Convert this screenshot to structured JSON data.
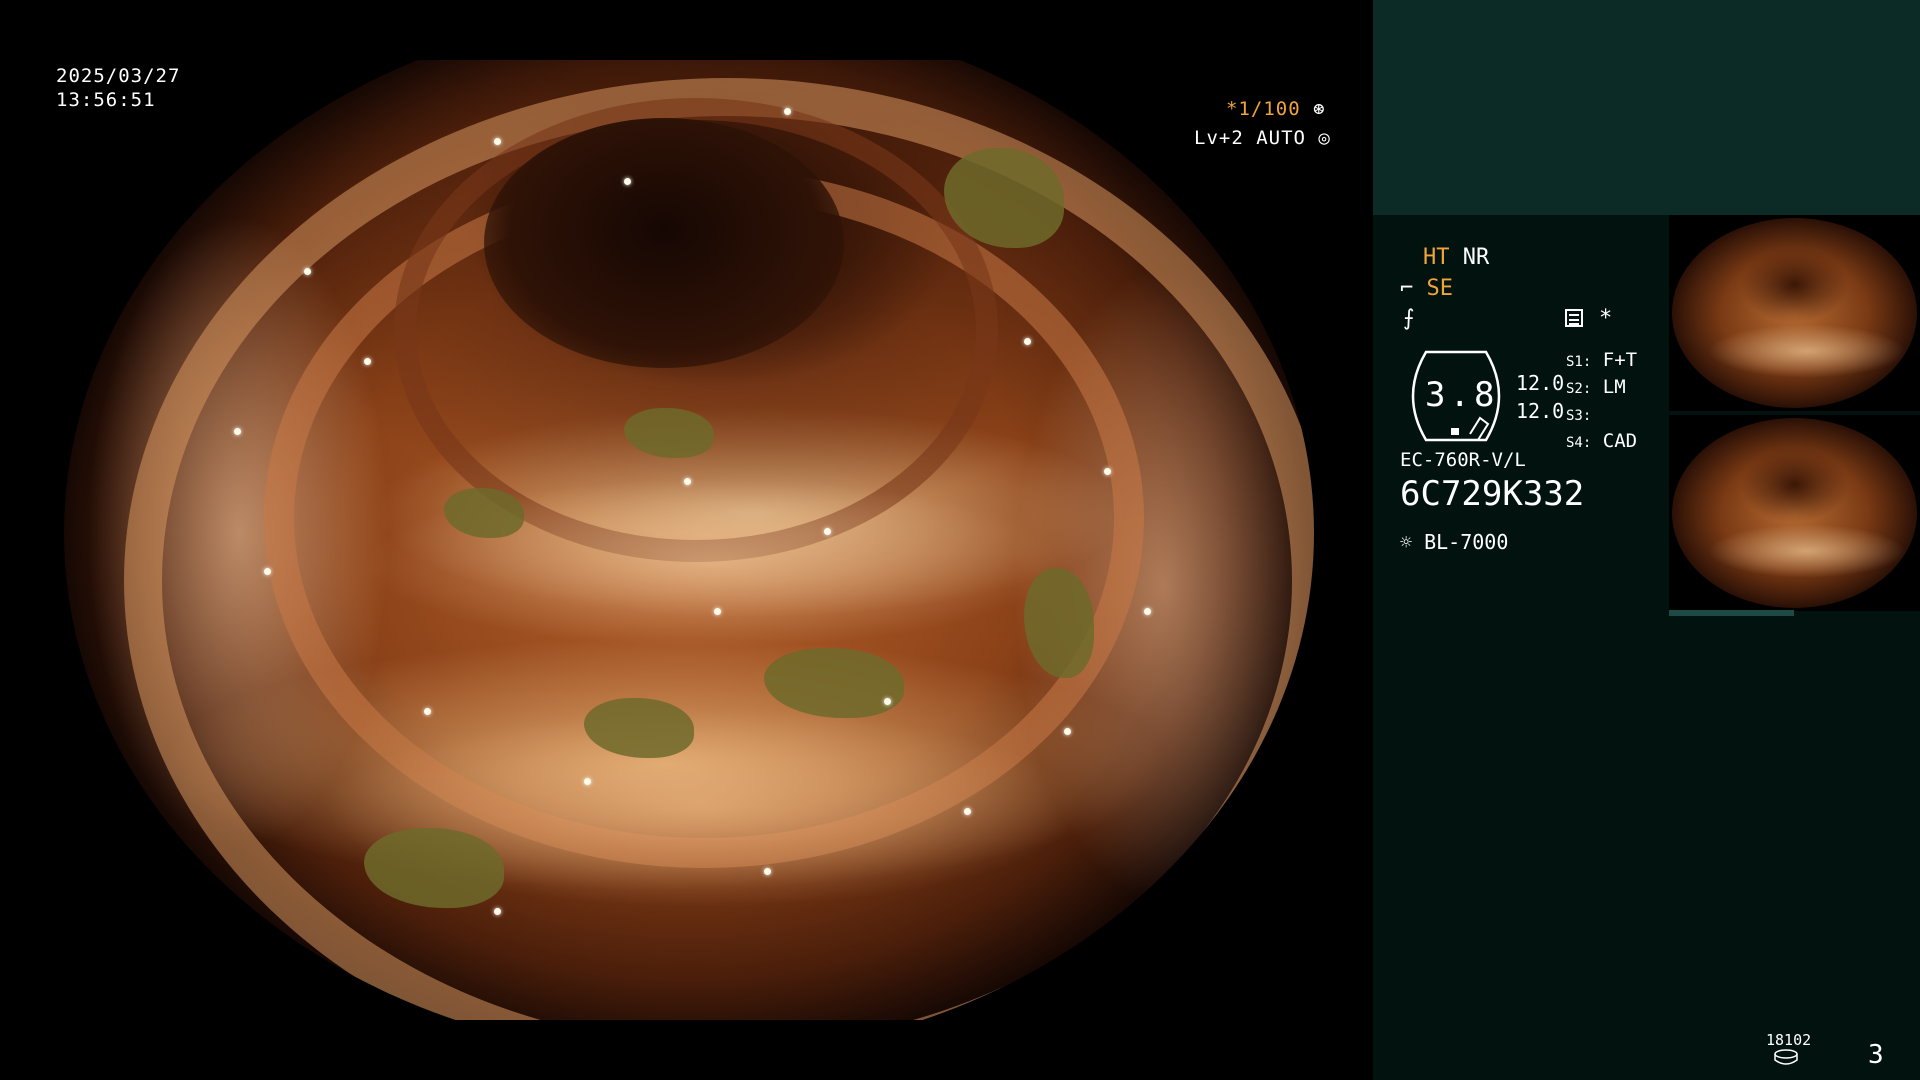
{
  "overlay": {
    "date": "2025/03/27",
    "time": "13:56:51",
    "shutter": "*1/100",
    "level_auto": "Lv+2 AUTO"
  },
  "panel": {
    "ht": "HT",
    "nr": "NR",
    "se": "SE",
    "asterisk": "*",
    "gauge_value": "3.8",
    "gauge_right_top": "12.0",
    "gauge_right_bottom": "12.0",
    "s1_label": "S1:",
    "s1_value": "F+T",
    "s2_label": "S2:",
    "s2_value": "LM",
    "s3_label": "S3:",
    "s3_value": "",
    "s4_label": "S4:",
    "s4_value": "CAD",
    "scope_model": "EC-760R-V/L",
    "serial": "6C729K332",
    "light_source": "BL-7000",
    "storage_count": "18102",
    "page_number": "3"
  },
  "colors": {
    "accent": "#f0a43a",
    "panel_top": "#0c2a26",
    "panel_bottom": "#02120f"
  }
}
